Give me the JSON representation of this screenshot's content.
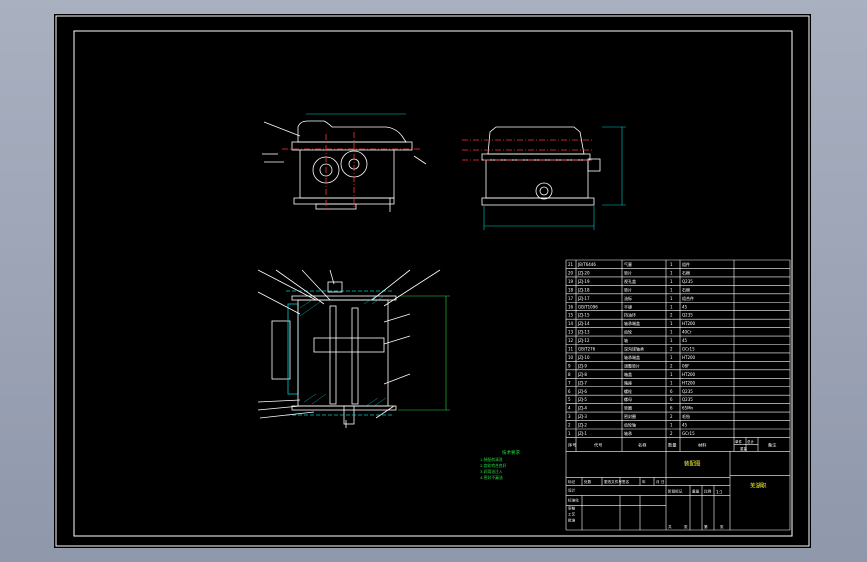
{
  "drawing": {
    "title_block": {
      "drawing_name": "装配图",
      "institution": "芜湖职",
      "scale": "1:1",
      "headers": [
        "序号",
        "代号",
        "名称",
        "数量",
        "材料",
        "单件",
        "总计",
        "重量",
        "备注"
      ],
      "mid_row": [
        "标记",
        "处数",
        "更改文件号",
        "签名",
        "年",
        "月",
        "日"
      ],
      "mid_right": [
        "阶段标记",
        "重量",
        "比例"
      ],
      "bottom_left": [
        "设计",
        "标准化",
        "审核",
        "工艺",
        "批准"
      ],
      "bottom_right": [
        "共",
        "张",
        "第",
        "张"
      ]
    },
    "notes": {
      "title": "技术要求",
      "lines": [
        "1.装配前清洗",
        "2.齿轮啮合良好",
        "3.润滑油注入",
        "4.密封不漏油"
      ]
    },
    "bom": [
      {
        "no": "21",
        "code": "JB/T6446",
        "name": "气塞",
        "qty": "1",
        "material": "组件"
      },
      {
        "no": "20",
        "code": "JZJ-20",
        "name": "垫片",
        "qty": "1",
        "material": "石棉"
      },
      {
        "no": "19",
        "code": "JZJ-19",
        "name": "视孔盖",
        "qty": "1",
        "material": "Q235"
      },
      {
        "no": "18",
        "code": "JZJ-18",
        "name": "垫片",
        "qty": "1",
        "material": "石棉"
      },
      {
        "no": "17",
        "code": "JZJ-17",
        "name": "油标",
        "qty": "1",
        "material": "组合件"
      },
      {
        "no": "16",
        "code": "GB/T1096",
        "name": "平键",
        "qty": "1",
        "material": "45"
      },
      {
        "no": "15",
        "code": "JZJ-15",
        "name": "挡油环",
        "qty": "2",
        "material": "Q235"
      },
      {
        "no": "14",
        "code": "JZJ-14",
        "name": "轴承端盖",
        "qty": "1",
        "material": "HT200"
      },
      {
        "no": "13",
        "code": "JZJ-13",
        "name": "齿轮",
        "qty": "1",
        "material": "40Cr"
      },
      {
        "no": "12",
        "code": "JZJ-12",
        "name": "轴",
        "qty": "1",
        "material": "45"
      },
      {
        "no": "11",
        "code": "GB/T276",
        "name": "深沟球轴承",
        "qty": "2",
        "material": "GCr15"
      },
      {
        "no": "10",
        "code": "JZJ-10",
        "name": "轴承端盖",
        "qty": "1",
        "material": "HT200"
      },
      {
        "no": "9",
        "code": "JZJ-9",
        "name": "调整垫片",
        "qty": "2",
        "material": "08F"
      },
      {
        "no": "8",
        "code": "JZJ-8",
        "name": "箱盖",
        "qty": "1",
        "material": "HT200"
      },
      {
        "no": "7",
        "code": "JZJ-7",
        "name": "箱座",
        "qty": "1",
        "material": "HT200"
      },
      {
        "no": "6",
        "code": "JZJ-6",
        "name": "螺栓",
        "qty": "6",
        "material": "Q235"
      },
      {
        "no": "5",
        "code": "JZJ-5",
        "name": "螺母",
        "qty": "6",
        "material": "Q235"
      },
      {
        "no": "4",
        "code": "JZJ-4",
        "name": "垫圈",
        "qty": "6",
        "material": "65Mn"
      },
      {
        "no": "3",
        "code": "JZJ-3",
        "name": "密封圈",
        "qty": "2",
        "material": "毛毡"
      },
      {
        "no": "2",
        "code": "JZJ-2",
        "name": "齿轮轴",
        "qty": "1",
        "material": "45"
      },
      {
        "no": "1",
        "code": "JZJ-1",
        "name": "轴承",
        "qty": "2",
        "material": "GCr15"
      }
    ]
  },
  "colors": {
    "background": "#000000",
    "frame": "#ffffff",
    "outline": "#ffffff",
    "accent_cyan": "#00cccc",
    "accent_red": "#ff3333",
    "accent_green": "#22dd44",
    "accent_yellow": "#ffff33"
  }
}
